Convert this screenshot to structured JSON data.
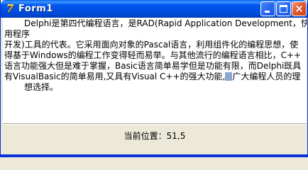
{
  "window": {
    "title": "Form1",
    "app_icon": "delphi-app-icon",
    "icon_glyph": "7",
    "controls": {
      "minimize": "minimize-icon",
      "maximize": "maximize-icon",
      "close": "close-icon",
      "close_glyph": "×"
    }
  },
  "memo": {
    "lines": [
      "Delphi是第四代编程语言，是RAD(Rapid Application Development，快速应",
      "用程序",
      "开发)工具的代表。它采用面向对象的Pascal语言，利用组件化的编程思想，使",
      "得基于Windows的编程工作变得轻而易举。与其他流行的编程语言相比，C++",
      "语言功能强大但是难于掌握，Basic语言简单易学但是功能有限，而Delphi既具",
      "有VisualBasic的简单易用,又具有Visual C++的强大功能,",
      "广大编程人员的理",
      "想选择。"
    ]
  },
  "status": {
    "position_label": "当前位置：51,5"
  },
  "colors": {
    "titlebar": "#0054e3",
    "window_border": "#0831d9",
    "client_bg": "#ece9d8",
    "memo_bg": "#ffffff",
    "close_button": "#e2582f"
  }
}
